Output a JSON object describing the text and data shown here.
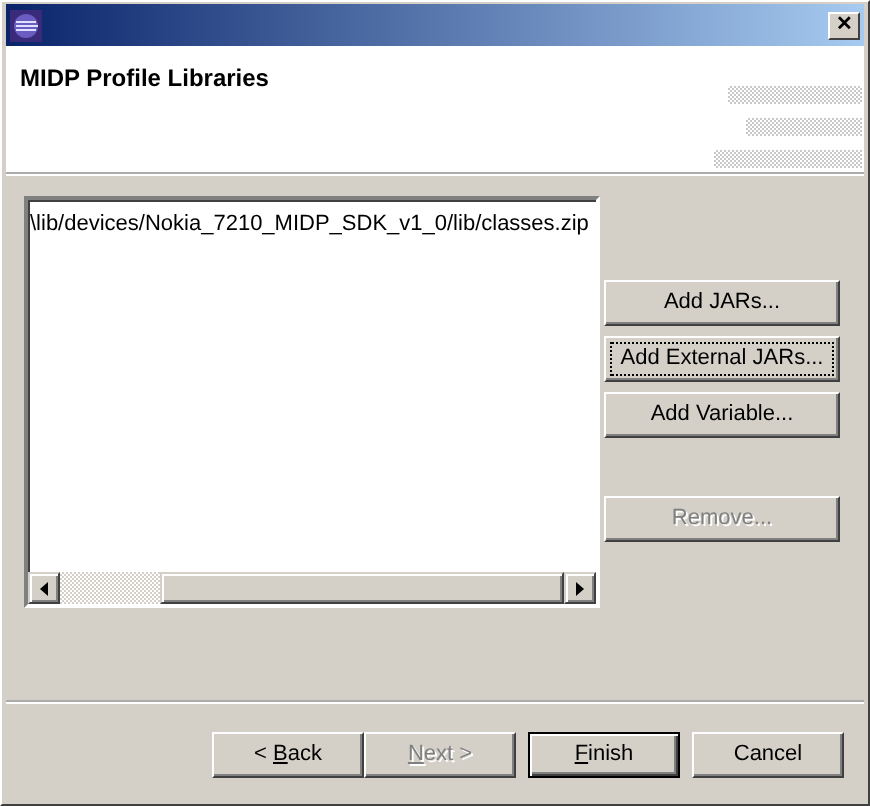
{
  "window": {
    "close": "✕"
  },
  "header": {
    "title": "MIDP Profile Libraries"
  },
  "library_list": {
    "items": [
      {
        "text": "\\lib/devices/Nokia_7210_MIDP_SDK_v1_0/lib/classes.zip",
        "selected": false
      }
    ]
  },
  "side_buttons": [
    {
      "label": "Add JARs...",
      "disabled": false,
      "focused": false
    },
    {
      "label": "Add External JARs...",
      "disabled": false,
      "focused": true
    },
    {
      "label": "Add Variable...",
      "disabled": false,
      "focused": false
    },
    {
      "label": "Remove...",
      "disabled": true,
      "focused": false
    }
  ],
  "footer_buttons": [
    {
      "parts": [
        {
          "text": "< ",
          "mnemonic": false
        },
        {
          "text": "B",
          "mnemonic": true
        },
        {
          "text": "ack",
          "mnemonic": false
        }
      ],
      "disabled": false,
      "default": false
    },
    {
      "parts": [
        {
          "text": "N",
          "mnemonic": true
        },
        {
          "text": "ext >",
          "mnemonic": false
        }
      ],
      "disabled": true,
      "default": false
    },
    {
      "parts": [
        {
          "text": "F",
          "mnemonic": true
        },
        {
          "text": "inish",
          "mnemonic": false
        }
      ],
      "disabled": false,
      "default": true
    },
    {
      "parts": [
        {
          "text": "Cancel",
          "mnemonic": false
        }
      ],
      "disabled": false,
      "default": false
    }
  ]
}
